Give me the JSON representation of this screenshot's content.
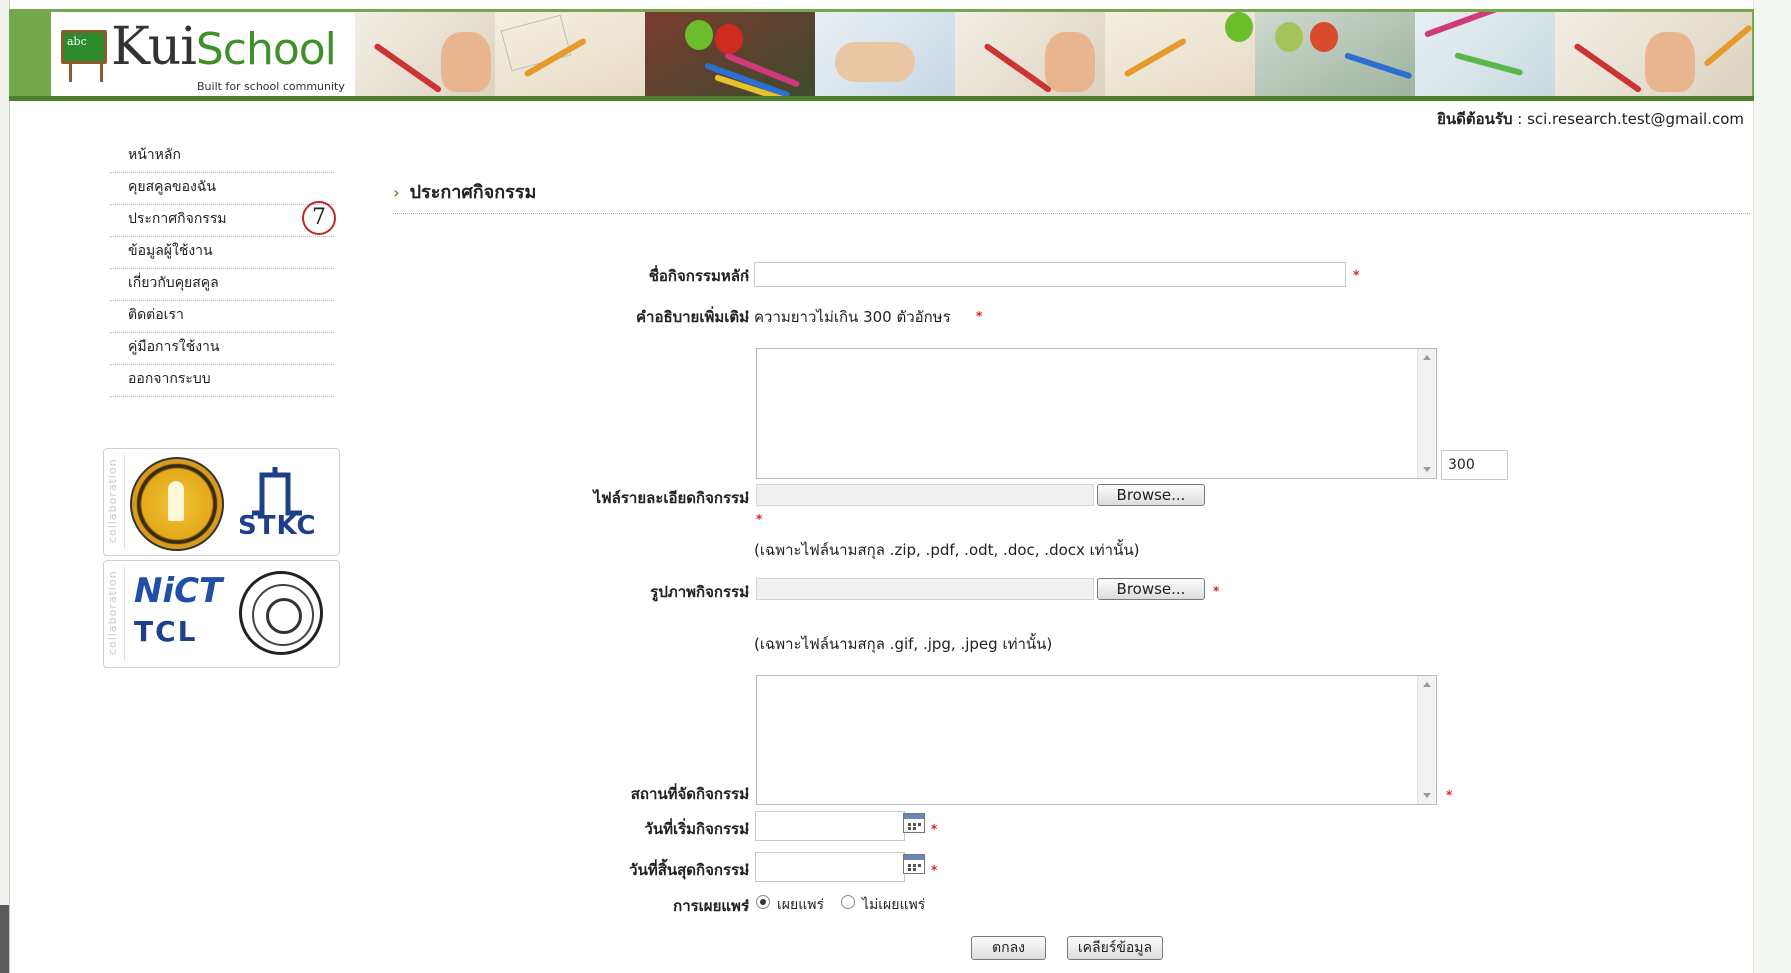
{
  "header": {
    "logo_part1": "Kui",
    "logo_part2": "School",
    "logo_tagline": "Built for school community",
    "logo_board_text": "abc"
  },
  "welcome": {
    "label": "ยินดีต้อนรับ",
    "sep": " : ",
    "user": "sci.research.test@gmail.com"
  },
  "sidebar": {
    "items": [
      {
        "label": "หน้าหลัก"
      },
      {
        "label": "คุยสคูลของฉัน"
      },
      {
        "label": "ประกาศกิจกรรม"
      },
      {
        "label": "ข้อมูลผู้ใช้งาน"
      },
      {
        "label": "เกี่ยวกับคุยสคูล"
      },
      {
        "label": "ติดต่อเรา"
      },
      {
        "label": "คู่มือการใช้งาน"
      },
      {
        "label": "ออกจากระบบ"
      }
    ],
    "callout": "7",
    "collab_label": "collaboration",
    "partner1": "STKC",
    "partner2a": "NiCT",
    "partner2b": "TCL"
  },
  "page": {
    "title": "ประกาศกิจกรรม",
    "chevron": "›"
  },
  "form": {
    "activity_name_label": "ชื่อกิจกรรมหลัก",
    "description_label": "คำอธิบายเพิ่มเติม",
    "description_hint": "ความยาวไม่เกิน 300 ตัวอักษร",
    "char_counter": "300",
    "detail_file_label": "ไฟล์รายละเอียดกิจกรรม",
    "browse_label": "Browse...",
    "detail_file_hint": "(เฉพาะไฟล์นามสกุล .zip, .pdf, .odt, .doc, .docx เท่านั้น)",
    "image_label": "รูปภาพกิจกรรม",
    "image_hint": "(เฉพาะไฟล์นามสกุล .gif, .jpg, .jpeg เท่านั้น)",
    "location_label": "สถานที่จัดกิจกรรม",
    "start_date_label": "วันที่เริ่มกิจกรรม",
    "end_date_label": "วันที่สิ้นสุดกิจกรรม",
    "publish_label": "การเผยแพร่",
    "publish_yes": "เผยแพร่",
    "publish_no": "ไม่เผยแพร่",
    "colon": ":",
    "required_mark": "*",
    "submit_label": "ตกลง",
    "clear_label": "เคลียร์ข้อมูล"
  },
  "colors": {
    "header_green": "#74a84a",
    "accent_green": "#5e9c2f",
    "required_red": "#d22222"
  }
}
